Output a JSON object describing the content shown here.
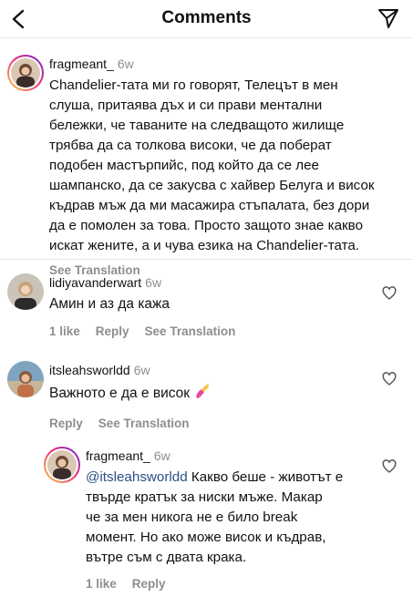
{
  "header": {
    "title": "Comments",
    "back_icon": "chevron-left-icon",
    "send_icon": "paper-plane-icon"
  },
  "comments": [
    {
      "username": "fragmeant_",
      "time": "6w",
      "lines": [
        "Chandelier-тата ми го говорят, Телецът в мен",
        "слуша, притаява дъх и си прави ментални",
        "бележки, че таваните на следващото жилище",
        "трябва да са толкова високи, че да поберат",
        "подобен мастърпийс, под който да се лее",
        "шампанско, да се закусва с хайвер Белуга и висок",
        "къдрав мъж да ми масажира стъпалата, без дори",
        "да е помолен за това. Просто защото знае какво",
        "искат жените, а и чува езика на Chandelier-тата."
      ],
      "actions": {
        "see_translation": "See Translation"
      }
    },
    {
      "username": "lidiyavanderwart",
      "time": "6w",
      "text": "Амин и аз да кажа",
      "actions": {
        "likes": "1 like",
        "reply": "Reply",
        "see_translation": "See Translation"
      }
    },
    {
      "username": "itsleahsworldd",
      "time": "6w",
      "text": "Важното е да е висок",
      "emoji": "nail-polish-emoji",
      "actions": {
        "reply": "Reply",
        "see_translation": "See Translation"
      }
    },
    {
      "username": "fragmeant_",
      "time": "6w",
      "mention": "@itsleahsworldd",
      "first_line_rest": " Какво беше - животът е",
      "lines": [
        "твърде кратък за ниски мъже. Макар",
        "че за мен никога не е било break",
        "момент. Но ако може висок и къдрав,",
        "вътре съм с двата крака."
      ],
      "actions": {
        "likes": "1 like",
        "reply": "Reply"
      }
    }
  ],
  "colors": {
    "muted": "#8e8e8e",
    "mention": "#2b4f86",
    "divider": "#e6e6e6"
  }
}
